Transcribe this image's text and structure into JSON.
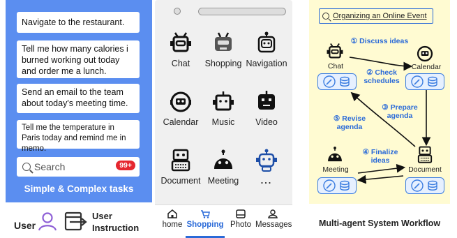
{
  "panel1": {
    "tasks": [
      "Navigate to the restaurant.",
      "Tell me how many calories i burned working out today and order me a lunch.",
      "Send an email to the team about today's meeting time.",
      "Tell me the temperature in Paris today and remind me in memo."
    ],
    "search_placeholder": "Search",
    "badge": "99+",
    "title": "Simple & Complex tasks",
    "legend_user": "User",
    "legend_instruction_line1": "User",
    "legend_instruction_line2": "Instruction"
  },
  "panel2": {
    "apps": [
      "Chat",
      "Shopping",
      "Navigation",
      "Calendar",
      "Music",
      "Video",
      "Document",
      "Meeting",
      "..."
    ],
    "nav": [
      "home",
      "Shopping",
      "Photo",
      "Messages"
    ],
    "active_nav": "Shopping",
    "accent": "#2a6ad8"
  },
  "panel3": {
    "query": "Organizing an Online Event",
    "steps": [
      {
        "num": "①",
        "text": "Discuss ideas"
      },
      {
        "num": "②",
        "text": "Check schedules"
      },
      {
        "num": "③",
        "text": "Prepare agenda"
      },
      {
        "num": "④",
        "text": "Finalize ideas"
      },
      {
        "num": "⑤",
        "text": "Revise agenda"
      }
    ],
    "agents": [
      "Chat",
      "Calendar",
      "Meeting",
      "Document"
    ],
    "title": "Multi-agent System Workflow",
    "background": "#fffbd2",
    "accent": "#2a6ad8"
  }
}
